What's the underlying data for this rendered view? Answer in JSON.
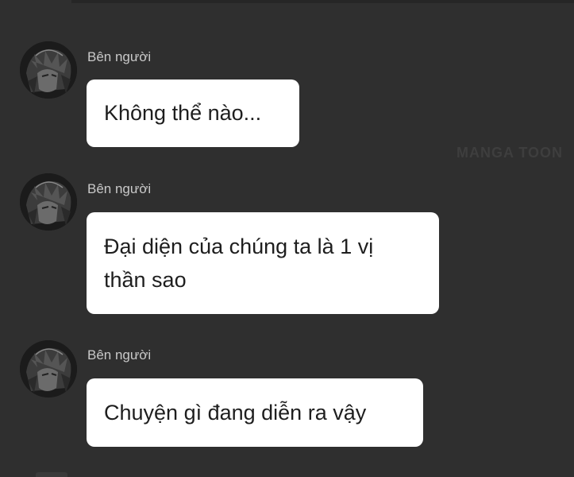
{
  "watermark": "MANGA TOON",
  "messages": [
    {
      "sender": "Bên người",
      "text": "Không thể nào..."
    },
    {
      "sender": "Bên người",
      "text": "Đại diện của chúng ta là 1 vị thần sao"
    },
    {
      "sender": "Bên người",
      "text": "Chuyện gì đang diễn ra vậy"
    }
  ],
  "icons": {
    "avatar": "avatar-icon"
  },
  "colors": {
    "background": "#2f2f2f",
    "bubble": "#ffffff",
    "bubble_text": "#1e1e1e",
    "sender_text": "#c9c9c9"
  }
}
